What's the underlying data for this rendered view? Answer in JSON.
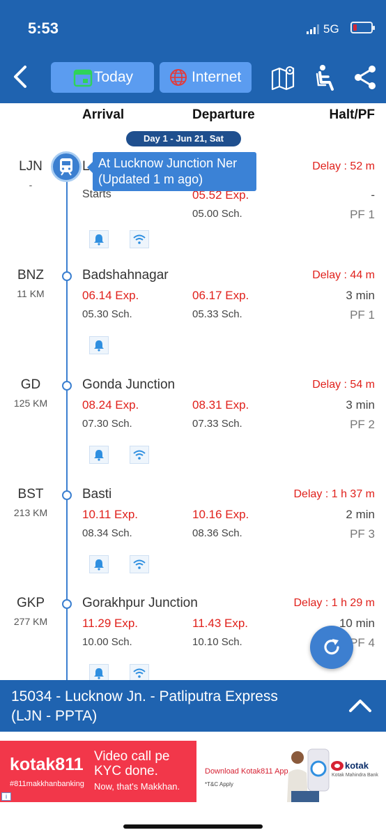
{
  "status": {
    "time": "5:53",
    "network": "5G"
  },
  "toolbar": {
    "today_label": "Today",
    "internet_label": "Internet"
  },
  "columns": {
    "arrival": "Arrival",
    "departure": "Departure",
    "halt_pf": "Halt/PF"
  },
  "day_badge": "Day 1 - Jun 21, Sat",
  "current_tooltip": {
    "line1": "At Lucknow Junction Ner",
    "line2": "(Updated  1 m ago)"
  },
  "stations": [
    {
      "code": "LJN",
      "km": "-",
      "name": "L",
      "arrival_exp": "Starts",
      "arrival_sch": "",
      "departure_exp": "05.52 Exp.",
      "departure_sch": "05.00 Sch.",
      "delay": "Delay : 52 m",
      "halt": "-",
      "pf": "PF 1",
      "wifi": true
    },
    {
      "code": "BNZ",
      "km": "11 KM",
      "name": "Badshahnagar",
      "arrival_exp": "06.14 Exp.",
      "arrival_sch": "05.30 Sch.",
      "departure_exp": "06.17 Exp.",
      "departure_sch": "05.33 Sch.",
      "delay": "Delay : 44 m",
      "halt": "3 min",
      "pf": "PF 1",
      "wifi": false
    },
    {
      "code": "GD",
      "km": "125 KM",
      "name": "Gonda Junction",
      "arrival_exp": "08.24 Exp.",
      "arrival_sch": "07.30 Sch.",
      "departure_exp": "08.31 Exp.",
      "departure_sch": "07.33 Sch.",
      "delay": "Delay : 54 m",
      "halt": "3 min",
      "pf": "PF 2",
      "wifi": true
    },
    {
      "code": "BST",
      "km": "213 KM",
      "name": "Basti",
      "arrival_exp": "10.11 Exp.",
      "arrival_sch": "08.34 Sch.",
      "departure_exp": "10.16 Exp.",
      "departure_sch": "08.36 Sch.",
      "delay": "Delay : 1 h  37 m",
      "halt": "2 min",
      "pf": "PF 3",
      "wifi": true
    },
    {
      "code": "GKP",
      "km": "277 KM",
      "name": "Gorakhpur Junction",
      "arrival_exp": "11.29 Exp.",
      "arrival_sch": "10.00 Sch.",
      "departure_exp": "11.43 Exp.",
      "departure_sch": "10.10 Sch.",
      "delay": "Delay : 1 h  29 m",
      "halt": "10 min",
      "pf": "PF 4",
      "wifi": true
    }
  ],
  "train_bar": {
    "line1": "15034 - Lucknow Jn. - Patliputra Express",
    "line2": "(LJN - PPTA)"
  },
  "ad": {
    "brand": "kotak811",
    "hashtag": "#811makkhanbanking",
    "headline1": "Video call pe",
    "headline2": "KYC done.",
    "subline": "Now, that's Makkhan.",
    "download": "Download Kotak811 App",
    "tc": "*T&C Apply",
    "bank_brand": "kotak",
    "bank_name": "Kotak Mahindra Bank"
  },
  "colors": {
    "primary": "#1f63b0",
    "delay": "#e0201b",
    "ad_bg": "#f2374a"
  },
  "icons": [
    "back-icon",
    "calendar-icon",
    "globe-icon",
    "route-map-icon",
    "seat-icon",
    "share-icon",
    "train-icon",
    "alarm-icon",
    "wifi-icon",
    "refresh-icon",
    "chevron-up-icon",
    "info-icon"
  ]
}
